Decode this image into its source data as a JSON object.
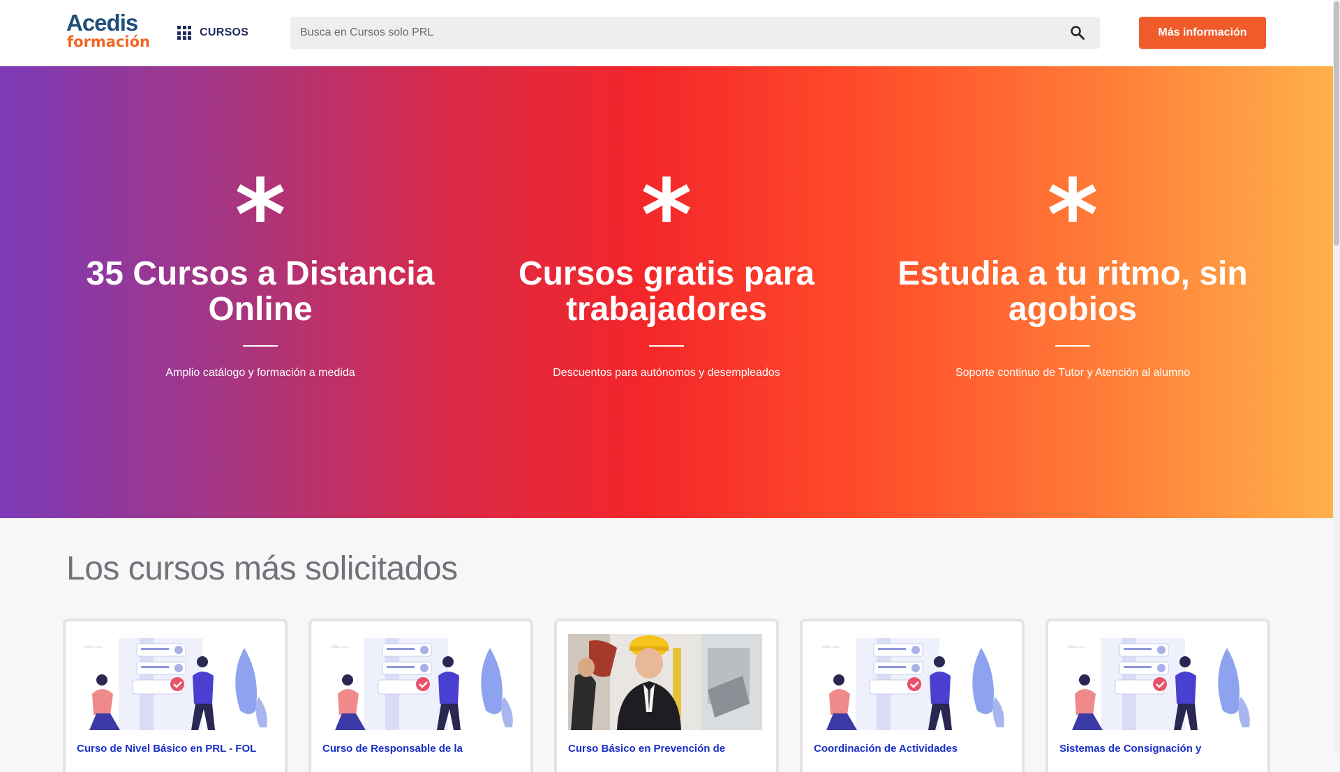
{
  "header": {
    "logo": {
      "line1": "Acedis",
      "line2": "formación",
      "brand_color": "#1f4e79",
      "accent_color": "#f26522"
    },
    "cursos_label": "CURSOS",
    "cursos_icon": "apps-grid-icon",
    "search": {
      "placeholder": "Busca en Cursos solo PRL",
      "value": "",
      "icon": "search-icon"
    },
    "cta_label": "Más información",
    "cta_color": "#ef5b2b"
  },
  "hero": {
    "features": [
      {
        "symbol": "*",
        "title": "35 Cursos a Distancia Online",
        "subtitle": "Amplio catálogo y formación a medida"
      },
      {
        "symbol": "*",
        "title": "Cursos gratis para trabajadores",
        "subtitle": "Descuentos para autónomos y desempleados"
      },
      {
        "symbol": "*",
        "title": "Estudia a tu ritmo, sin agobios",
        "subtitle": "Soporte continuo de Tutor y Atención al alumno"
      }
    ]
  },
  "courses_section": {
    "title": "Los cursos más solicitados",
    "cards": [
      {
        "title": "Curso de Nivel Básico en PRL - FOL",
        "image": "illustration-people-checklist"
      },
      {
        "title": "Curso de Responsable de la",
        "image": "illustration-people-checklist"
      },
      {
        "title": "Curso Básico en Prevención de",
        "image": "photo-engineer-hardhat"
      },
      {
        "title": "Coordinación de Actividades",
        "image": "illustration-people-checklist"
      },
      {
        "title": "Sistemas de Consignación y",
        "image": "illustration-people-checklist"
      }
    ]
  }
}
